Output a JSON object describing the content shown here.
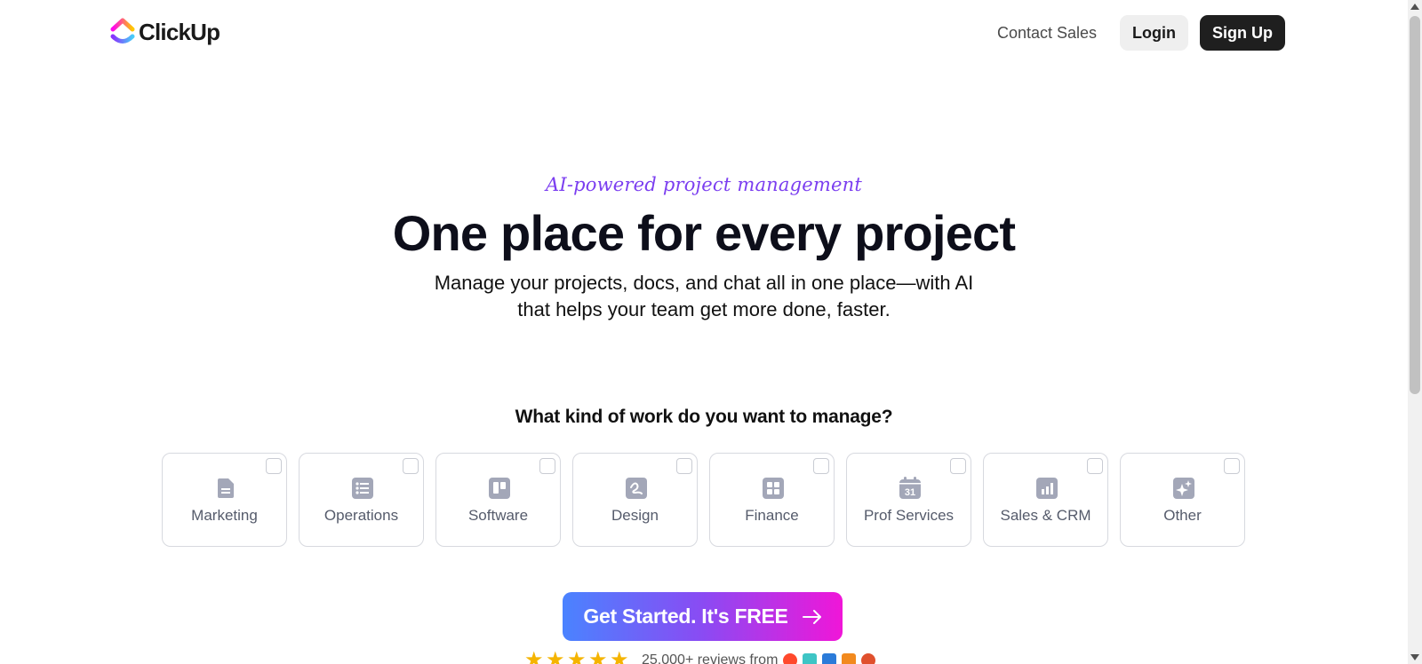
{
  "header": {
    "logo_text": "ClickUp",
    "contact_label": "Contact Sales",
    "login_label": "Login",
    "signup_label": "Sign Up"
  },
  "hero": {
    "tagline": "AI-powered project management",
    "title": "One place for every project",
    "subtitle_line1": "Manage your projects, docs, and chat all in one place—with AI",
    "subtitle_line2": "that helps your team get more done, faster."
  },
  "question": "What kind of work do you want to manage?",
  "categories": [
    {
      "label": "Marketing",
      "icon": "document-icon"
    },
    {
      "label": "Operations",
      "icon": "list-icon"
    },
    {
      "label": "Software",
      "icon": "board-icon"
    },
    {
      "label": "Design",
      "icon": "squiggle-icon"
    },
    {
      "label": "Finance",
      "icon": "grid-icon"
    },
    {
      "label": "Prof Services",
      "icon": "calendar-icon",
      "icon_text": "31"
    },
    {
      "label": "Sales & CRM",
      "icon": "bar-chart-icon"
    },
    {
      "label": "Other",
      "icon": "sparkle-icon"
    }
  ],
  "cta": {
    "label": "Get Started. It's FREE"
  },
  "reviews": {
    "rating_stars": 4.5,
    "text": "25,000+ reviews from"
  },
  "colors": {
    "accent_purple": "#7b3ef0",
    "card_icon": "#a3a7b8",
    "cta_gradient_start": "#4a83ff",
    "cta_gradient_end": "#f016d8",
    "star": "#f5b400"
  }
}
